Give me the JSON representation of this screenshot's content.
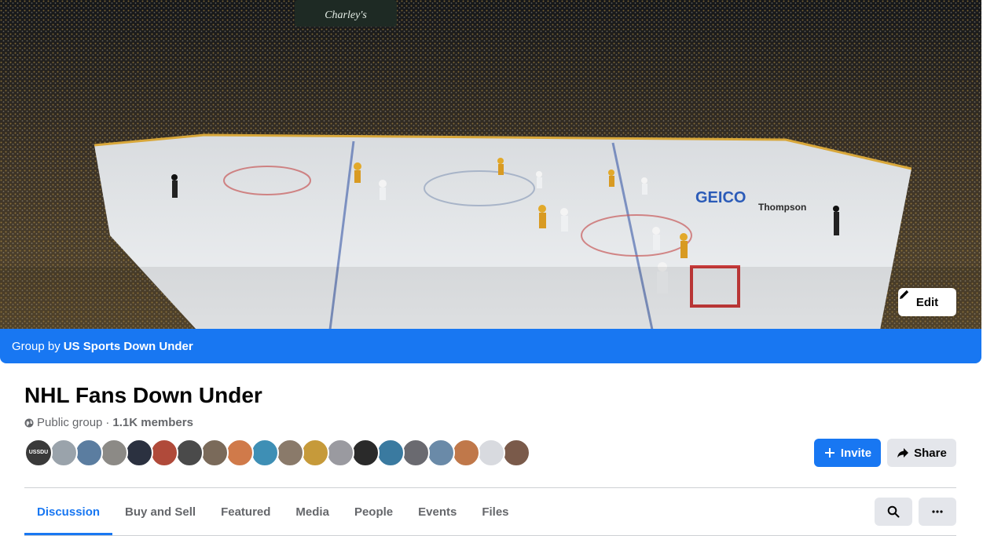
{
  "cover": {
    "scoreboard_text": "Charley's",
    "rink_ad": "GEICO",
    "rink_ad_2": "Thompson"
  },
  "edit_button": {
    "label": "Edit",
    "icon": "pencil-icon"
  },
  "group_by": {
    "prefix": "Group by",
    "owner": "US Sports Down Under"
  },
  "group": {
    "title": "NHL Fans Down Under",
    "privacy": "Public group",
    "separator": "·",
    "members": "1.1K members"
  },
  "avatars": [
    {
      "color": "#3a3a3a",
      "label": "USSDU"
    },
    {
      "color": "#9aa3ab",
      "label": ""
    },
    {
      "color": "#5b7da0",
      "label": ""
    },
    {
      "color": "#8c8a86",
      "label": ""
    },
    {
      "color": "#2b3140",
      "label": ""
    },
    {
      "color": "#b04a3a",
      "label": ""
    },
    {
      "color": "#4a4a4a",
      "label": ""
    },
    {
      "color": "#7a6a5a",
      "label": ""
    },
    {
      "color": "#d07a4a",
      "label": ""
    },
    {
      "color": "#3e8fb5",
      "label": ""
    },
    {
      "color": "#8a7a6a",
      "label": ""
    },
    {
      "color": "#c69a3a",
      "label": ""
    },
    {
      "color": "#9a9aa0",
      "label": ""
    },
    {
      "color": "#2a2a2a",
      "label": ""
    },
    {
      "color": "#3a7aa0",
      "label": ""
    },
    {
      "color": "#6a6a70",
      "label": ""
    },
    {
      "color": "#6a8aa8",
      "label": ""
    },
    {
      "color": "#c0784a",
      "label": ""
    },
    {
      "color": "#d8dadf",
      "label": ""
    },
    {
      "color": "#7a5a4a",
      "label": ""
    }
  ],
  "actions": {
    "invite_label": "Invite",
    "share_label": "Share"
  },
  "tabs": [
    {
      "label": "Discussion",
      "active": true
    },
    {
      "label": "Buy and Sell",
      "active": false
    },
    {
      "label": "Featured",
      "active": false
    },
    {
      "label": "Media",
      "active": false
    },
    {
      "label": "People",
      "active": false
    },
    {
      "label": "Events",
      "active": false
    },
    {
      "label": "Files",
      "active": false
    }
  ],
  "colors": {
    "accent": "#1877f2",
    "button_gray": "#e4e6eb",
    "secondary_text": "#65676b"
  }
}
